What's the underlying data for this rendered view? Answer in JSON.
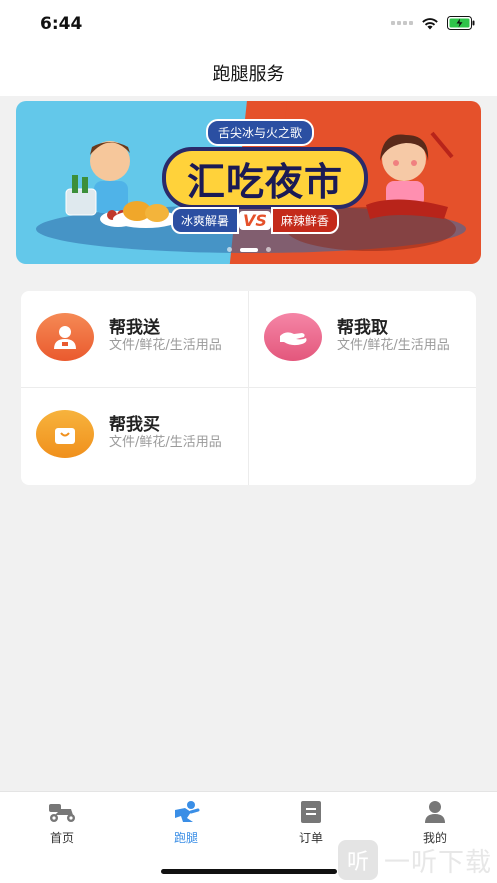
{
  "status": {
    "time": "6:44"
  },
  "nav": {
    "title": "跑腿服务"
  },
  "banner": {
    "tagline": "舌尖冰与火之歌",
    "headline": "汇吃夜市",
    "left_label": "冰爽解暑",
    "vs": "VS",
    "right_label": "麻辣鲜香",
    "pages": 3,
    "active_page": 2
  },
  "services": [
    {
      "title": "帮我送",
      "subtitle": "文件/鲜花/生活用品",
      "icon": "person-delivery-icon",
      "color": "#ef6a3a"
    },
    {
      "title": "帮我取",
      "subtitle": "文件/鲜花/生活用品",
      "icon": "hand-receive-icon",
      "color": "#ea5f86"
    },
    {
      "title": "帮我买",
      "subtitle": "文件/鲜花/生活用品",
      "icon": "shopping-bag-icon",
      "color": "#f5a228"
    }
  ],
  "tabs": [
    {
      "label": "首页",
      "icon": "scooter-icon",
      "active": false
    },
    {
      "label": "跑腿",
      "icon": "runner-icon",
      "active": true
    },
    {
      "label": "订单",
      "icon": "document-icon",
      "active": false
    },
    {
      "label": "我的",
      "icon": "user-icon",
      "active": false
    }
  ],
  "watermark": {
    "glyph": "听",
    "text": "一听下载"
  },
  "colors": {
    "accent": "#3a8ee6",
    "banner_blue": "#63c8ea",
    "banner_red": "#e5512b"
  }
}
